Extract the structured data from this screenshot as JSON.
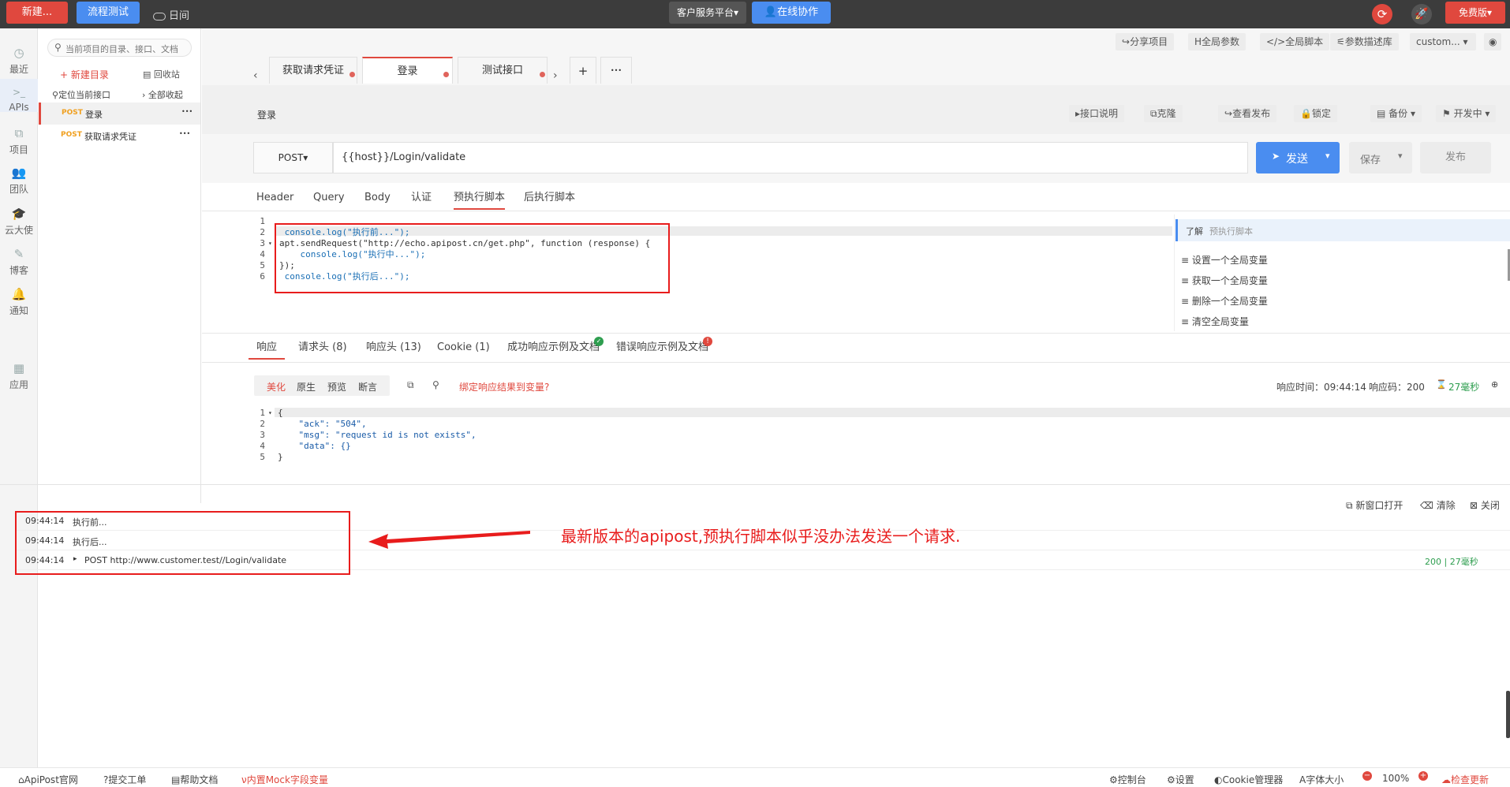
{
  "topbar": {
    "new_label": "新建...",
    "flow_test_label": "流程测试",
    "theme_toggle_label": "日间",
    "workspace_label": "客户服务平台",
    "collab_label": "在线协作",
    "plan_label": "免费版"
  },
  "rail": {
    "items": [
      {
        "label": "最近",
        "icon": "clock-icon"
      },
      {
        "label": "APIs",
        "icon": "terminal-icon"
      },
      {
        "label": "项目",
        "icon": "project-icon"
      },
      {
        "label": "团队",
        "icon": "team-icon"
      },
      {
        "label": "云大使",
        "icon": "hat-icon"
      },
      {
        "label": "博客",
        "icon": "edit-icon"
      },
      {
        "label": "通知",
        "icon": "bell-icon"
      },
      {
        "label": "应用",
        "icon": "grid-icon"
      }
    ]
  },
  "tree": {
    "search_placeholder": "当前项目的目录、接口、文档",
    "new_folder_label": "新建目录",
    "recycle_label": "回收站",
    "locate_label": "定位当前接口",
    "collapse_label": "全部收起",
    "items": [
      {
        "method": "POST",
        "name": "登录",
        "more": "•••"
      },
      {
        "method": "POST",
        "name": "获取请求凭证",
        "more": "•••"
      }
    ]
  },
  "toolbar": {
    "share_label": "分享项目",
    "global_params_label": "全局参数",
    "global_script_label": "全局脚本",
    "param_lib_label": "参数描述库",
    "env_label": "custom..."
  },
  "tabs": [
    {
      "label": "获取请求凭证"
    },
    {
      "label": "登录"
    },
    {
      "label": "测试接口"
    }
  ],
  "tab_controls": {
    "prev": "‹",
    "next": "›",
    "add": "+",
    "more": "•••"
  },
  "request": {
    "title": "登录",
    "actions": {
      "doc": "接口说明",
      "clone": "克隆",
      "view_publish": "查看发布",
      "lock": "锁定",
      "backup": "备份",
      "status": "开发中"
    },
    "method": "POST",
    "url": "{{host}}/Login/validate",
    "send_label": "发送",
    "save_label": "保存",
    "publish_label": "发布",
    "subtabs": [
      "Header",
      "Query",
      "Body",
      "认证",
      "预执行脚本",
      "后执行脚本"
    ]
  },
  "script": {
    "line_numbers": [
      "1",
      "2",
      "3",
      "4",
      "5",
      "6"
    ],
    "lines": [
      "",
      " console.log(\"执行前...\");",
      "apt.sendRequest(\"http://echo.apipost.cn/get.php\", function (response) {",
      "    console.log(\"执行中...\");",
      "});",
      " console.log(\"执行后...\");"
    ],
    "help_title": "了解",
    "help_sub": "预执行脚本",
    "snippets": [
      "设置一个全局变量",
      "获取一个全局变量",
      "删除一个全局变量",
      "清空全局变量"
    ]
  },
  "response": {
    "tabs": [
      "响应",
      "请求头 (8)",
      "响应头 (13)",
      "Cookie (1)",
      "成功响应示例及文档",
      "错误响应示例及文档"
    ],
    "view_modes": [
      "美化",
      "原生",
      "预览",
      "断言"
    ],
    "bind_label": "绑定响应结果到变量?",
    "time_label": "响应时间：09:44:14",
    "code_label": "响应码：200",
    "duration_label": "27毫秒",
    "line_numbers": [
      "1",
      "2",
      "3",
      "4",
      "5"
    ],
    "body_lines": [
      "{",
      "    \"ack\": \"504\",",
      "    \"msg\": \"request id is not exists\",",
      "    \"data\": {}",
      "}"
    ]
  },
  "console": {
    "new_window_label": "新窗口打开",
    "clear_label": "清除",
    "close_label": "关闭",
    "logs": [
      {
        "time": "09:44:14",
        "text": "执行前..."
      },
      {
        "time": "09:44:14",
        "text": "执行后..."
      },
      {
        "time": "09:44:14",
        "text": "POST http://www.customer.test//Login/validate"
      }
    ],
    "log_status": "200 | 27毫秒",
    "annotation": "最新版本的apipost,预执行脚本似乎没办法发送一个请求."
  },
  "footer": {
    "left": [
      "ApiPost官网",
      "提交工单",
      "帮助文档",
      "内置Mock字段变量"
    ],
    "right": [
      "控制台",
      "设置",
      "Cookie管理器",
      "字体大小",
      "100%",
      "检查更新"
    ]
  },
  "colors": {
    "brand_red": "#e0483e",
    "brand_blue": "#4a8df0",
    "method_orange": "#f0a020",
    "annotation_red": "#e81c1c"
  }
}
